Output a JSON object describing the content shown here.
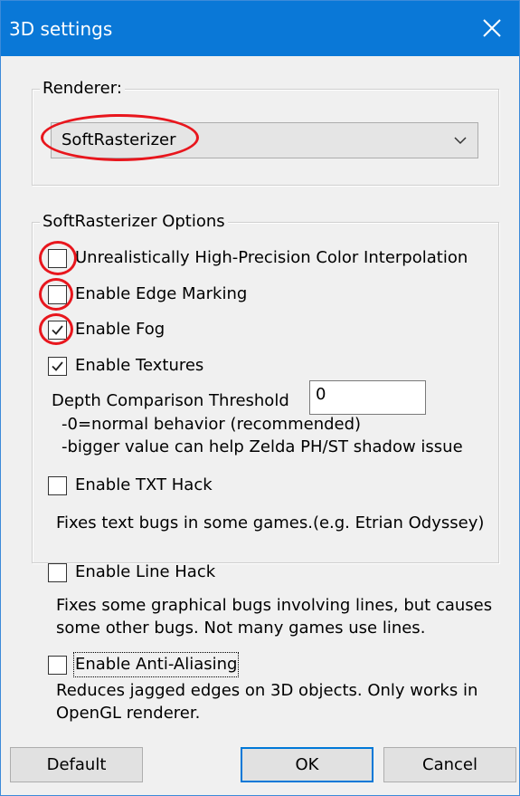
{
  "window": {
    "title": "3D settings",
    "accent_color": "#0a78d7",
    "close_icon": "close-icon"
  },
  "renderer_group": {
    "title": "Renderer:",
    "selected": "SoftRasterizer"
  },
  "soft_group": {
    "title": "SoftRasterizer Options",
    "options": [
      {
        "label": "Unrealistically High-Precision Color Interpolation",
        "checked": false
      },
      {
        "label": "Enable Edge Marking",
        "checked": false
      },
      {
        "label": "Enable Fog",
        "checked": true
      },
      {
        "label": "Enable Textures",
        "checked": true
      }
    ],
    "depth_label": "Depth Comparison Threshold",
    "depth_value": "0",
    "depth_hint_1": "-0=normal behavior (recommended)",
    "depth_hint_2": "-bigger value can help Zelda PH/ST shadow issue",
    "txt_hack_label": "Enable TXT Hack",
    "txt_hack_checked": false,
    "txt_hack_desc": "Fixes text bugs in some games.(e.g. Etrian Odyssey)"
  },
  "line_hack": {
    "label": "Enable Line Hack",
    "checked": false,
    "desc_1": "Fixes some graphical bugs involving lines, but causes",
    "desc_2": "some other bugs. Not many games use lines."
  },
  "anti_aliasing": {
    "label": "Enable Anti-Aliasing",
    "checked": false,
    "desc_1": "Reduces jagged edges on 3D objects. Only works in",
    "desc_2": "OpenGL renderer."
  },
  "buttons": {
    "default": "Default",
    "ok": "OK",
    "cancel": "Cancel"
  },
  "annotation_color": "#e8161d"
}
